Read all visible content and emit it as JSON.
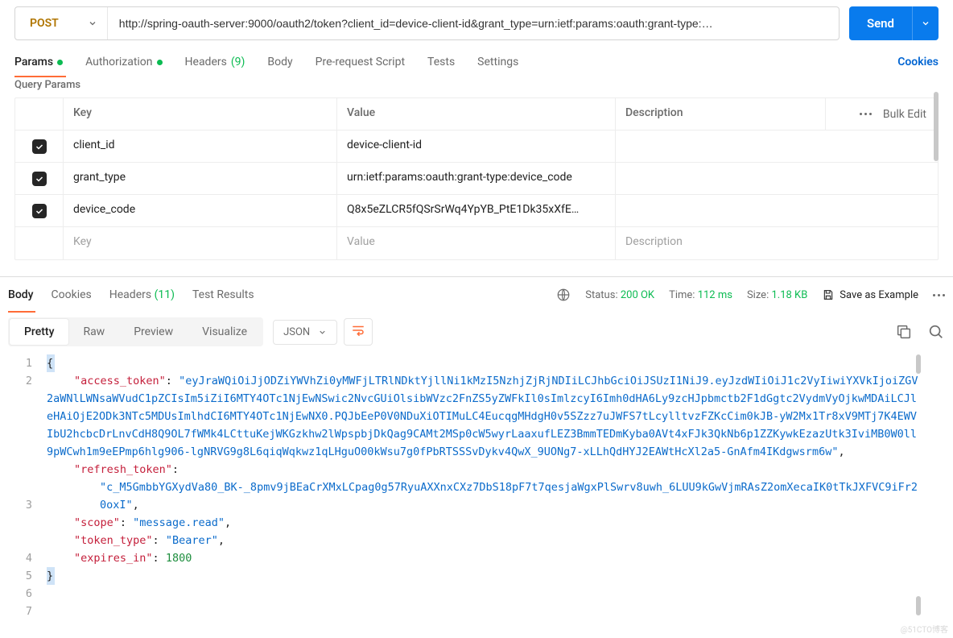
{
  "request": {
    "method": "POST",
    "url": "http://spring-oauth-server:9000/oauth2/token?client_id=device-client-id&grant_type=urn:ietf:params:oauth:grant-type:…",
    "send_label": "Send"
  },
  "tabs": {
    "params": "Params",
    "authorization": "Authorization",
    "headers": "Headers",
    "headers_count": "(9)",
    "body": "Body",
    "prerequest": "Pre-request Script",
    "tests": "Tests",
    "settings": "Settings",
    "cookies": "Cookies"
  },
  "section": {
    "query_params": "Query Params"
  },
  "table": {
    "head_key": "Key",
    "head_value": "Value",
    "head_desc": "Description",
    "bulk_edit": "Bulk Edit",
    "rows": [
      {
        "key": "client_id",
        "value": "device-client-id",
        "desc": ""
      },
      {
        "key": "grant_type",
        "value": "urn:ietf:params:oauth:grant-type:device_code",
        "desc": ""
      },
      {
        "key": "device_code",
        "value": "Q8x5eZLCR5fQSrSrWq4YpYB_PtE1Dk35xXfE…",
        "desc": ""
      }
    ],
    "ph_key": "Key",
    "ph_value": "Value",
    "ph_desc": "Description"
  },
  "response": {
    "body_tab": "Body",
    "cookies_tab": "Cookies",
    "headers_tab": "Headers",
    "headers_count": "(11)",
    "tests_tab": "Test Results",
    "status_label": "Status:",
    "status_value": "200 OK",
    "time_label": "Time:",
    "time_value": "112 ms",
    "size_label": "Size:",
    "size_value": "1.18 KB",
    "save_example": "Save as Example"
  },
  "view": {
    "pretty": "Pretty",
    "raw": "Raw",
    "preview": "Preview",
    "visualize": "Visualize",
    "format": "JSON"
  },
  "json": {
    "access_token_key": "\"access_token\"",
    "access_token_val": "\"eyJraWQiOiJjODZiYWVhZi0yMWFjLTRlNDktYjllNi1kMzI5NzhjZjRjNDIiLCJhbGciOiJSUzI1NiJ9.eyJzdWIiOiJ1c2VyIiwiYXVkIjoiZGV2aWNlLWNsaWVudC1pZCIsIm5iZiI6MTY4OTc1NjEwNSwic2NvcGUiOlsibWVzc2FnZS5yZWFkIl0sImlzcyI6Imh0dHA6Ly9zcHJpbmctb2F1dGgtc2VydmVyOjkwMDAiLCJleHAiOjE2ODk3NTc5MDUsImlhdCI6MTY4OTc1NjEwNX0.PQJbEeP0V0NDuXiOTIMuLC4EucqgMHdgH0v5SZzz7uJWFS7tLcylltvzFZKcCim0kJB-yW2Mx1Tr8xV9MTj7K4EWVIbU2hcbcDrLnvCdH8Q9OL7fWMk4LCttuKejWKGzkhw2lWpspbjDkQag9CAMt2MSp0cW5wyrLaaxufLEZ3BmmTEDmKyba0AVt4xFJk3QkNb6p1ZZKywkEzazUtk3IviMB0W0ll9pWCwh1m9eEPmp6hlg906-lgNRVG9g8L6qiqWqkwz1qLHguO00kWsu7g0fPbRTSSSvDykv4QwX_9UONg7-xLLhQdHYJ2EAWtHcXl2a5-GnAfm4IKdgwsrm6w\"",
    "refresh_token_key": "\"refresh_token\"",
    "refresh_token_val": "\"c_M5GmbbYGXydVa80_BK-_8pmv9jBEaCrXMxLCpag0g57RyuAXXnxCXz7DbS18pF7t7qesjaWgxPlSwrv8uwh_6LUU9kGwVjmRAsZ2omXecaIK0tTkJXFVC9iFr20oxI\"",
    "scope_key": "\"scope\"",
    "scope_val": "\"message.read\"",
    "token_type_key": "\"token_type\"",
    "token_type_val": "\"Bearer\"",
    "expires_in_key": "\"expires_in\"",
    "expires_in_val": "1800"
  },
  "gutter": [
    "1",
    "2",
    "3",
    "4",
    "5",
    "6",
    "7"
  ],
  "icons": {
    "chevron_down": "chevron-down-icon",
    "globe": "globe-icon",
    "save": "save-icon",
    "more": "more-icon",
    "copy": "copy-icon",
    "search": "search-icon",
    "wrap": "wrap-lines-icon"
  },
  "watermark": "@51CTO博客"
}
